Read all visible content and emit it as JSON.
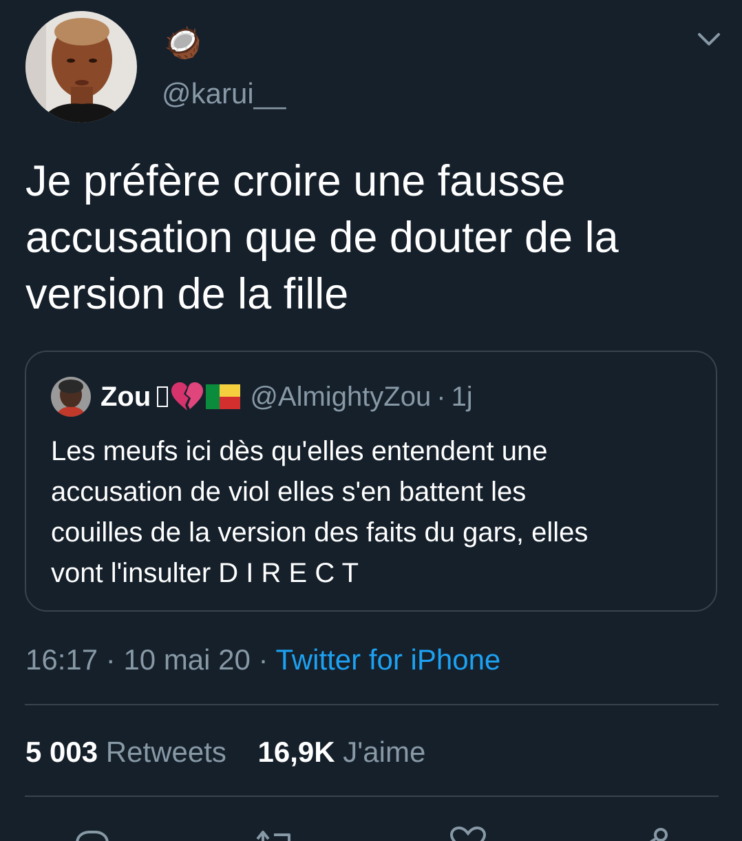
{
  "author": {
    "display_name": "🥥",
    "handle": "@karui__"
  },
  "tweet": {
    "text": "Je préfère croire une fausse\naccusation que de douter de la\nversion de la fille"
  },
  "quoted_tweet": {
    "name": "Zou",
    "name_emoji": "💔",
    "handle": "@AlmightyZou",
    "separator": "·",
    "time": "1j",
    "text": "Les meufs ici dès qu'elles entendent une\naccusation de viol elles s'en battent les\ncouilles de la version des faits du gars, elles\nvont l'insulter D I R E C T"
  },
  "meta": {
    "time": "16:17",
    "separator_1": " · ",
    "date": "10 mai 20",
    "separator_2": " · ",
    "source": "Twitter for iPhone"
  },
  "stats": {
    "retweets_count": "5 003",
    "retweets_label": "Retweets",
    "likes_count": "16,9K",
    "likes_label": "J'aime"
  },
  "colors": {
    "background": "#15202b",
    "border": "#38444d",
    "secondary_text": "#8899a6",
    "link": "#1da1f2"
  },
  "icons": {
    "menu": "chevron-down-icon",
    "reply": "reply-icon",
    "retweet": "retweet-icon",
    "like": "heart-icon",
    "share": "share-icon"
  }
}
